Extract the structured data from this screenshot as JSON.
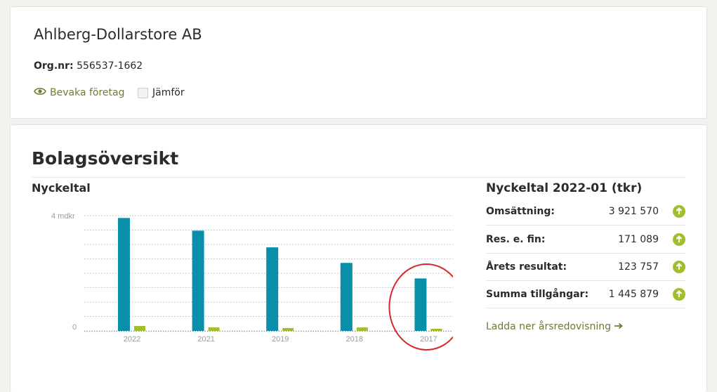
{
  "company": {
    "name": "Ahlberg-Dollarstore AB",
    "org_label": "Org.nr:",
    "org_number": "556537-1662",
    "watch_label": "Bevaka företag",
    "compare_label": "Jämför"
  },
  "overview": {
    "title": "Bolagsöversikt",
    "left_heading": "Nyckeltal",
    "right_heading": "Nyckeltal 2022-01 (tkr)"
  },
  "key_figures": [
    {
      "label": "Omsättning:",
      "value": "3 921 570"
    },
    {
      "label": "Res. e. fin:",
      "value": "171 089"
    },
    {
      "label": "Årets resultat:",
      "value": "123 757"
    },
    {
      "label": "Summa tillgångar:",
      "value": "1 445 879"
    }
  ],
  "download_label": "Ladda ner årsredovisning",
  "colors": {
    "primary_bar": "#0a8fab",
    "secondary_bar": "#a2bd2d",
    "accent_green": "#6c7c31",
    "highlight_circle": "#d9262c"
  },
  "chart_data": {
    "type": "bar",
    "categories": [
      "2022",
      "2021",
      "2019",
      "2018",
      "2017"
    ],
    "series": [
      {
        "values": [
          3.92,
          3.48,
          2.9,
          2.36,
          1.82
        ]
      },
      {
        "values": [
          0.17,
          0.12,
          0.1,
          0.12,
          0.05
        ]
      }
    ],
    "ytick_labels": [
      "4 mdkr",
      "0"
    ],
    "ylim": [
      0,
      4
    ],
    "grid": true,
    "annotation": "red circle around 2017"
  }
}
